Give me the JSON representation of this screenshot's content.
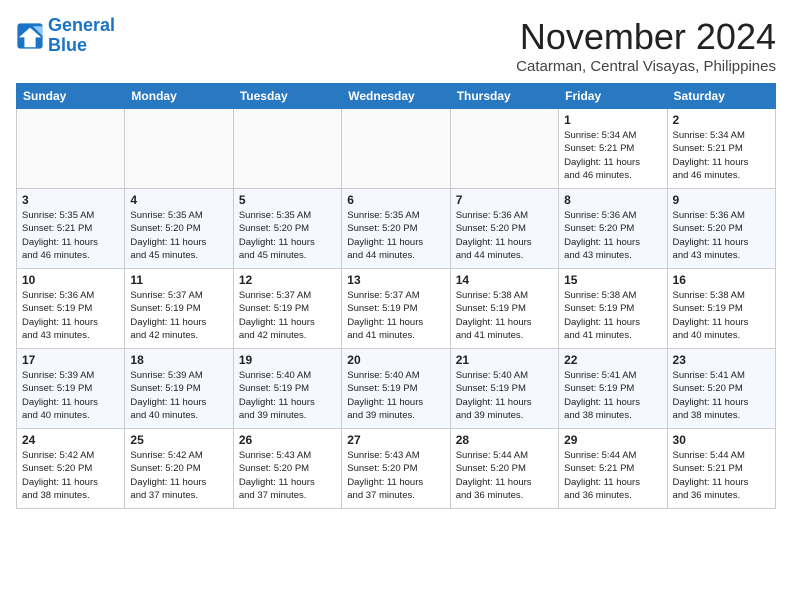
{
  "logo": {
    "line1": "General",
    "line2": "Blue"
  },
  "title": "November 2024",
  "location": "Catarman, Central Visayas, Philippines",
  "weekdays": [
    "Sunday",
    "Monday",
    "Tuesday",
    "Wednesday",
    "Thursday",
    "Friday",
    "Saturday"
  ],
  "weeks": [
    [
      {
        "day": "",
        "info": ""
      },
      {
        "day": "",
        "info": ""
      },
      {
        "day": "",
        "info": ""
      },
      {
        "day": "",
        "info": ""
      },
      {
        "day": "",
        "info": ""
      },
      {
        "day": "1",
        "info": "Sunrise: 5:34 AM\nSunset: 5:21 PM\nDaylight: 11 hours\nand 46 minutes."
      },
      {
        "day": "2",
        "info": "Sunrise: 5:34 AM\nSunset: 5:21 PM\nDaylight: 11 hours\nand 46 minutes."
      }
    ],
    [
      {
        "day": "3",
        "info": "Sunrise: 5:35 AM\nSunset: 5:21 PM\nDaylight: 11 hours\nand 46 minutes."
      },
      {
        "day": "4",
        "info": "Sunrise: 5:35 AM\nSunset: 5:20 PM\nDaylight: 11 hours\nand 45 minutes."
      },
      {
        "day": "5",
        "info": "Sunrise: 5:35 AM\nSunset: 5:20 PM\nDaylight: 11 hours\nand 45 minutes."
      },
      {
        "day": "6",
        "info": "Sunrise: 5:35 AM\nSunset: 5:20 PM\nDaylight: 11 hours\nand 44 minutes."
      },
      {
        "day": "7",
        "info": "Sunrise: 5:36 AM\nSunset: 5:20 PM\nDaylight: 11 hours\nand 44 minutes."
      },
      {
        "day": "8",
        "info": "Sunrise: 5:36 AM\nSunset: 5:20 PM\nDaylight: 11 hours\nand 43 minutes."
      },
      {
        "day": "9",
        "info": "Sunrise: 5:36 AM\nSunset: 5:20 PM\nDaylight: 11 hours\nand 43 minutes."
      }
    ],
    [
      {
        "day": "10",
        "info": "Sunrise: 5:36 AM\nSunset: 5:19 PM\nDaylight: 11 hours\nand 43 minutes."
      },
      {
        "day": "11",
        "info": "Sunrise: 5:37 AM\nSunset: 5:19 PM\nDaylight: 11 hours\nand 42 minutes."
      },
      {
        "day": "12",
        "info": "Sunrise: 5:37 AM\nSunset: 5:19 PM\nDaylight: 11 hours\nand 42 minutes."
      },
      {
        "day": "13",
        "info": "Sunrise: 5:37 AM\nSunset: 5:19 PM\nDaylight: 11 hours\nand 41 minutes."
      },
      {
        "day": "14",
        "info": "Sunrise: 5:38 AM\nSunset: 5:19 PM\nDaylight: 11 hours\nand 41 minutes."
      },
      {
        "day": "15",
        "info": "Sunrise: 5:38 AM\nSunset: 5:19 PM\nDaylight: 11 hours\nand 41 minutes."
      },
      {
        "day": "16",
        "info": "Sunrise: 5:38 AM\nSunset: 5:19 PM\nDaylight: 11 hours\nand 40 minutes."
      }
    ],
    [
      {
        "day": "17",
        "info": "Sunrise: 5:39 AM\nSunset: 5:19 PM\nDaylight: 11 hours\nand 40 minutes."
      },
      {
        "day": "18",
        "info": "Sunrise: 5:39 AM\nSunset: 5:19 PM\nDaylight: 11 hours\nand 40 minutes."
      },
      {
        "day": "19",
        "info": "Sunrise: 5:40 AM\nSunset: 5:19 PM\nDaylight: 11 hours\nand 39 minutes."
      },
      {
        "day": "20",
        "info": "Sunrise: 5:40 AM\nSunset: 5:19 PM\nDaylight: 11 hours\nand 39 minutes."
      },
      {
        "day": "21",
        "info": "Sunrise: 5:40 AM\nSunset: 5:19 PM\nDaylight: 11 hours\nand 39 minutes."
      },
      {
        "day": "22",
        "info": "Sunrise: 5:41 AM\nSunset: 5:19 PM\nDaylight: 11 hours\nand 38 minutes."
      },
      {
        "day": "23",
        "info": "Sunrise: 5:41 AM\nSunset: 5:20 PM\nDaylight: 11 hours\nand 38 minutes."
      }
    ],
    [
      {
        "day": "24",
        "info": "Sunrise: 5:42 AM\nSunset: 5:20 PM\nDaylight: 11 hours\nand 38 minutes."
      },
      {
        "day": "25",
        "info": "Sunrise: 5:42 AM\nSunset: 5:20 PM\nDaylight: 11 hours\nand 37 minutes."
      },
      {
        "day": "26",
        "info": "Sunrise: 5:43 AM\nSunset: 5:20 PM\nDaylight: 11 hours\nand 37 minutes."
      },
      {
        "day": "27",
        "info": "Sunrise: 5:43 AM\nSunset: 5:20 PM\nDaylight: 11 hours\nand 37 minutes."
      },
      {
        "day": "28",
        "info": "Sunrise: 5:44 AM\nSunset: 5:20 PM\nDaylight: 11 hours\nand 36 minutes."
      },
      {
        "day": "29",
        "info": "Sunrise: 5:44 AM\nSunset: 5:21 PM\nDaylight: 11 hours\nand 36 minutes."
      },
      {
        "day": "30",
        "info": "Sunrise: 5:44 AM\nSunset: 5:21 PM\nDaylight: 11 hours\nand 36 minutes."
      }
    ]
  ]
}
